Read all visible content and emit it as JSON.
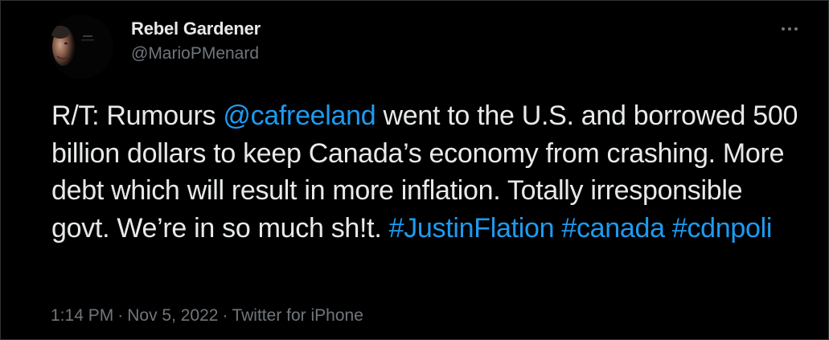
{
  "author": {
    "display_name": "Rebel Gardener",
    "handle": "@MarioPMenard"
  },
  "tweet": {
    "text_segments": [
      {
        "type": "text",
        "value": "R/T: Rumours "
      },
      {
        "type": "mention",
        "value": "@cafreeland"
      },
      {
        "type": "text",
        "value": " went to the U.S. and borrowed 500 billion dollars to keep Canada’s economy from crashing. More debt which will result in more inflation. Totally irresponsible govt. We’re in so much sh!t. "
      },
      {
        "type": "hashtag",
        "value": "#JustinFlation"
      },
      {
        "type": "text",
        "value": " "
      },
      {
        "type": "hashtag",
        "value": "#canada"
      },
      {
        "type": "text",
        "value": " "
      },
      {
        "type": "hashtag",
        "value": "#cdnpoli"
      }
    ]
  },
  "meta": {
    "time": "1:14 PM",
    "separator": "·",
    "date": "Nov 5, 2022",
    "source": "Twitter for iPhone"
  },
  "icons": {
    "more": "more-horizontal-icon"
  },
  "colors": {
    "background": "#000000",
    "text": "#e7e9ea",
    "secondary": "#71767b",
    "link": "#1d9bf0"
  }
}
